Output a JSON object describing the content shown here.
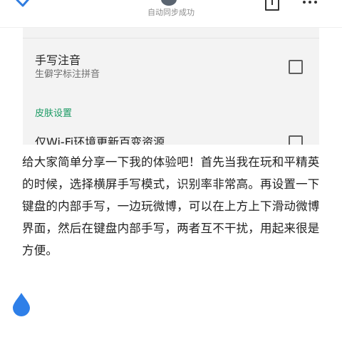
{
  "header": {
    "sync_status": "自动同步成功",
    "icons": [
      "check-icon",
      "avatar",
      "share-icon",
      "more-icon"
    ]
  },
  "settings": {
    "items": [
      {
        "title": "手写注音",
        "subtitle": "生僻字标注拼音",
        "checked": false
      }
    ],
    "section_header": "皮肤设置",
    "partial_item": {
      "title": "仅Wi-Fi环境更新百变资源",
      "checked": false
    }
  },
  "article": {
    "text": "给大家简单分享一下我的体验吧！首先当我在玩和平精英的时候，选择横屏手写模式，识别率非常高。再设置一下键盘的内部手写，一边玩微博，可以在上方上下滑动微博界面，然后在键盘内部手写，两者互不干扰，用起来很是方便。"
  },
  "colors": {
    "accent_check": "#2f7ce0",
    "section_green": "#1a9a63",
    "drop_blue": "#2e7fe8",
    "panel_bg": "#f3f3f3"
  }
}
